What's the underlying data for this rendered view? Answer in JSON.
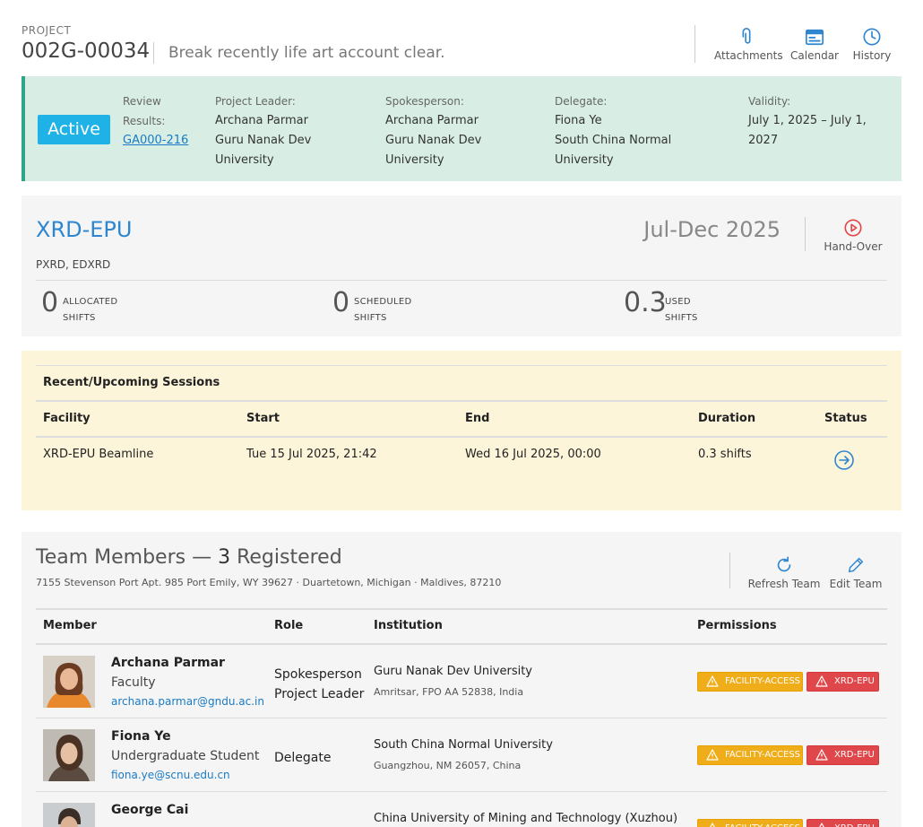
{
  "project": {
    "label": "PROJECT",
    "id": "002G-00034",
    "title": "Break recently life art account clear."
  },
  "header_actions": [
    {
      "label": "Attachments",
      "icon": "paperclip-icon"
    },
    {
      "label": "Calendar",
      "icon": "calendar-icon"
    },
    {
      "label": "History",
      "icon": "clock-icon"
    }
  ],
  "status": {
    "badge": "Active",
    "review_label": "Review",
    "results_label": "Results:",
    "review_link": "GA000-216",
    "leader_label": "Project Leader:",
    "leader_name": "Archana Parmar",
    "leader_inst_1": "Guru Nanak Dev",
    "leader_inst_2": "University",
    "spokes_label": "Spokesperson:",
    "spokes_name": "Archana Parmar",
    "spokes_inst_1": "Guru Nanak Dev",
    "spokes_inst_2": "University",
    "delegate_label": "Delegate:",
    "delegate_name": "Fiona Ye",
    "delegate_inst_1": "South China Normal",
    "delegate_inst_2": "University",
    "validity_label": "Validity:",
    "validity_1": "July 1, 2025 – July 1,",
    "validity_2": "2027"
  },
  "beamline": {
    "name": "XRD-EPU",
    "techniques": "PXRD, EDXRD",
    "period": "Jul-Dec 2025",
    "handover_label": "Hand-Over",
    "stats": [
      {
        "value": "0",
        "line1": "ALLOCATED",
        "line2": "SHIFTS"
      },
      {
        "value": "0",
        "line1": "SCHEDULED",
        "line2": "SHIFTS"
      },
      {
        "value": "0.3",
        "line1": "USED",
        "line2": "SHIFTS"
      }
    ]
  },
  "sessions": {
    "title": "Recent/Upcoming Sessions",
    "headers": [
      "Facility",
      "Start",
      "End",
      "Duration",
      "Status"
    ],
    "rows": [
      {
        "facility": "XRD-EPU Beamline",
        "start": "Tue 15 Jul 2025, 21:42",
        "end": "Wed 16 Jul 2025, 00:00",
        "duration": "0.3 shifts"
      }
    ]
  },
  "team": {
    "title_prefix": "Team Members — ",
    "count": "3",
    "title_suffix": " Registered",
    "address": "7155 Stevenson Port Apt. 985 Port Emily, WY 39627 · Duartetown, Michigan · Maldives, 87210",
    "refresh_label": "Refresh Team",
    "edit_label": "Edit Team",
    "headers": [
      "Member",
      "Role",
      "Institution",
      "Permissions"
    ],
    "perm_labels": [
      "FACILITY-ACCESS",
      "XRD-EPU"
    ],
    "members": [
      {
        "name": "Archana Parmar",
        "position": "Faculty",
        "email": "archana.parmar@gndu.ac.in",
        "role_1": "Spokesperson",
        "role_2": "Project Leader",
        "institution": "Guru Nanak Dev University",
        "inst_address": "Amritsar, FPO AA 52838, India"
      },
      {
        "name": "Fiona Ye",
        "position": "Undergraduate Student",
        "email": "fiona.ye@scnu.edu.cn",
        "role_1": "Delegate",
        "role_2": "",
        "institution": "South China Normal University",
        "inst_address": "Guangzhou, NM 26057, China"
      },
      {
        "name": "George Cai",
        "position": "",
        "email": "",
        "role_1": "",
        "role_2": "",
        "institution": "China University of Mining and Technology (Xuzhou)",
        "inst_address": ""
      }
    ]
  },
  "colors": {
    "accent_blue": "#2e86d0",
    "active_badge": "#1eb2e6",
    "facility_access": "#f0ad1a",
    "xrd_epu_perm": "#e0474a",
    "status_panel": "#d8eee4",
    "sessions_bg": "#fcf5da"
  }
}
